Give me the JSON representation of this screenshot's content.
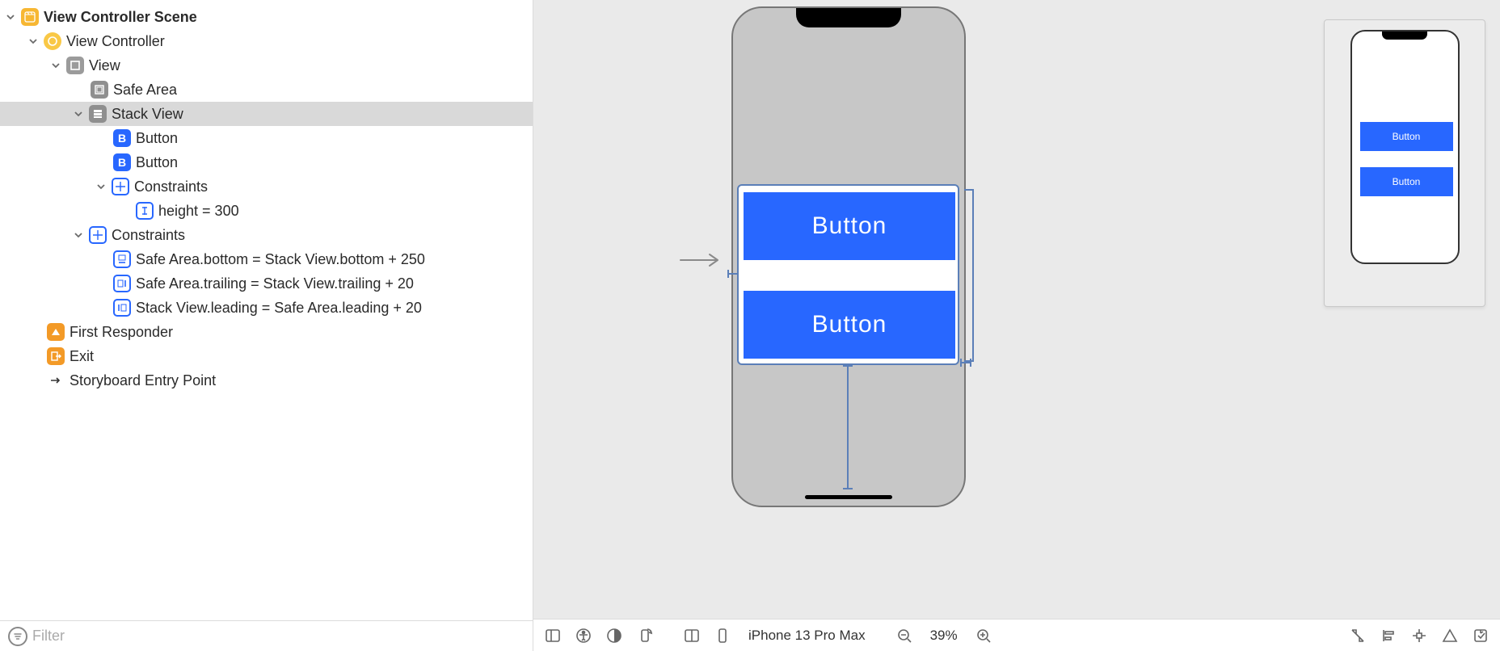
{
  "outline": {
    "scene": "View Controller Scene",
    "vc": "View Controller",
    "view": "View",
    "safe": "Safe Area",
    "stack": "Stack View",
    "button": "Button",
    "constraints": "Constraints",
    "height": "height = 300",
    "c_bottom": "Safe Area.bottom = Stack View.bottom + 250",
    "c_trailing": "Safe Area.trailing = Stack View.trailing + 20",
    "c_leading": "Stack View.leading = Safe Area.leading + 20",
    "first": "First Responder",
    "exit": "Exit",
    "entry": "Storyboard Entry Point"
  },
  "filter": {
    "placeholder": "Filter"
  },
  "canvas": {
    "button_label": "Button"
  },
  "bottombar": {
    "device": "iPhone 13 Pro Max",
    "zoom": "39%"
  }
}
